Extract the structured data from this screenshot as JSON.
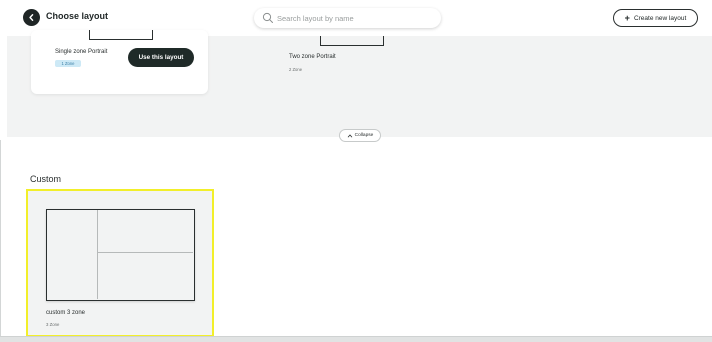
{
  "header": {
    "title": "Choose layout",
    "search_placeholder": "Search layout by name",
    "create_button_label": "Create new layout"
  },
  "preset_layouts": [
    {
      "name": "Single zone Portrait",
      "zone_label": "1 Zone",
      "action_label": "Use this layout"
    },
    {
      "name": "Two zone Portrait",
      "zone_label": "2 Zone"
    }
  ],
  "collapse_label": "Collapse",
  "custom_section": {
    "title": "Custom",
    "layouts": [
      {
        "name": "custom 3 zone",
        "zone_label": "3 Zone"
      }
    ]
  },
  "colors": {
    "dark": "#1f2626",
    "highlight": "#f2ef2a",
    "badge_bg": "#cde9f6",
    "panel_bg": "#f2f3f3"
  },
  "icons": {
    "back": "chevron-left-icon",
    "search": "search-icon",
    "create": "plus-icon",
    "collapse": "chevron-up-icon"
  }
}
